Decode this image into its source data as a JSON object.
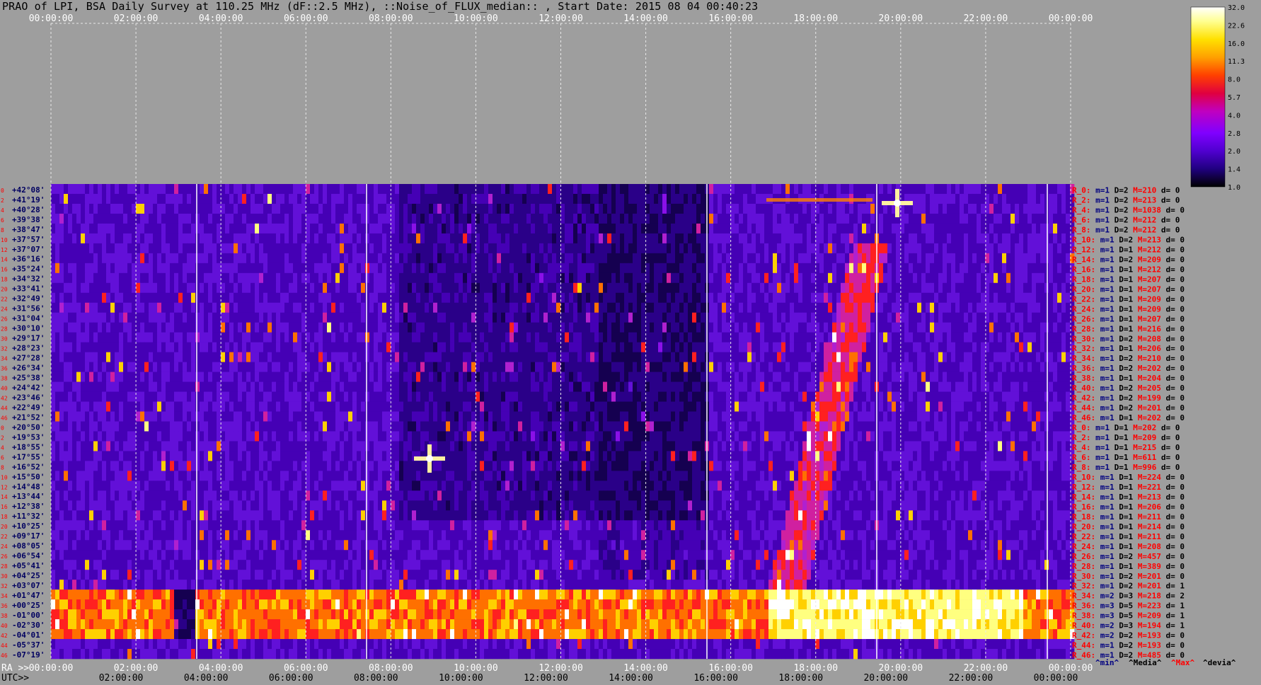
{
  "title": "PRAO of LPI, BSA Daily Survey at 110.25 MHz (dF::2.5 MHz), ::Noise_of_FLUX_median:: , Start Date: 2015 08 04 00:40:23",
  "chart_data": {
    "type": "heatmap",
    "top_axis_ticks": [
      "00:00:00",
      "02:00:00",
      "04:00:00",
      "06:00:00",
      "08:00:00",
      "10:00:00",
      "12:00:00",
      "14:00:00",
      "16:00:00",
      "18:00:00",
      "20:00:00",
      "22:00:00",
      "00:00:00"
    ],
    "ra_label": "RA >>",
    "ra_ticks": [
      "00:00:00",
      "02:00:00",
      "04:00:00",
      "06:00:00",
      "08:00:00",
      "10:00:00",
      "12:00:00",
      "14:00:00",
      "16:00:00",
      "18:00:00",
      "20:00:00",
      "22:00:00",
      "00:00:00"
    ],
    "utc_label": "UTC>>",
    "utc_ticks": [
      "02:00:00",
      "04:00:00",
      "06:00:00",
      "08:00:00",
      "10:00:00",
      "12:00:00",
      "14:00:00",
      "16:00:00",
      "18:00:00",
      "20:00:00",
      "22:00:00",
      "00:00:00"
    ],
    "declinations": [
      "+42°08'",
      "+41°19'",
      "+40°28'",
      "+39°38'",
      "+38°47'",
      "+37°57'",
      "+37°07'",
      "+36°16'",
      "+35°24'",
      "+34°32'",
      "+33°41'",
      "+32°49'",
      "+31°56'",
      "+31°04'",
      "+30°10'",
      "+29°17'",
      "+28°23'",
      "+27°28'",
      "+26°34'",
      "+25°38'",
      "+24°42'",
      "+23°46'",
      "+22°49'",
      "+21°52'",
      "+20°50'",
      "+19°53'",
      "+18°55'",
      "+17°55'",
      "+16°52'",
      "+15°50'",
      "+14°48'",
      "+13°44'",
      "+12°38'",
      "+11°32'",
      "+10°25'",
      "+09°17'",
      "+08°05'",
      "+06°54'",
      "+05°41'",
      "+04°25'",
      "+03°07'",
      "+01°47'",
      "+00°25'",
      "-01°00'",
      "-02°30'",
      "-04°01'",
      "-05°37'",
      "-07°19'"
    ],
    "colorbar_ticks": [
      "32.0",
      "22.6",
      "16.0",
      "11.3",
      "8.0",
      "5.7",
      "4.0",
      "2.8",
      "2.0",
      "1.4",
      "1.0"
    ],
    "colorbar_colors": [
      "#ffffff",
      "#ffff90",
      "#ffe000",
      "#ffa000",
      "#ff4000",
      "#e00040",
      "#c000c0",
      "#8000ff",
      "#5000d0",
      "#200080",
      "#000000"
    ],
    "receivers": [
      {
        "r": "R_0:",
        "m": "m=1",
        "D": "D=2",
        "M": "M=210",
        "d": "d= 0"
      },
      {
        "r": "R_2:",
        "m": "m=1",
        "D": "D=2",
        "M": "M=213",
        "d": "d= 0"
      },
      {
        "r": "R_4:",
        "m": "m=1",
        "D": "D=2",
        "M": "M=1038",
        "d": "d= 0"
      },
      {
        "r": "R_6:",
        "m": "m=1",
        "D": "D=2",
        "M": "M=212",
        "d": "d= 0"
      },
      {
        "r": "R_8:",
        "m": "m=1",
        "D": "D=2",
        "M": "M=212",
        "d": "d= 0"
      },
      {
        "r": "R_10:",
        "m": "m=1",
        "D": "D=2",
        "M": "M=213",
        "d": "d= 0"
      },
      {
        "r": "R_12:",
        "m": "m=1",
        "D": "D=1",
        "M": "M=212",
        "d": "d= 0"
      },
      {
        "r": "R_14:",
        "m": "m=1",
        "D": "D=2",
        "M": "M=209",
        "d": "d= 0"
      },
      {
        "r": "R_16:",
        "m": "m=1",
        "D": "D=1",
        "M": "M=212",
        "d": "d= 0"
      },
      {
        "r": "R_18:",
        "m": "m=1",
        "D": "D=1",
        "M": "M=207",
        "d": "d= 0"
      },
      {
        "r": "R_20:",
        "m": "m=1",
        "D": "D=1",
        "M": "M=207",
        "d": "d= 0"
      },
      {
        "r": "R_22:",
        "m": "m=1",
        "D": "D=1",
        "M": "M=209",
        "d": "d= 0"
      },
      {
        "r": "R_24:",
        "m": "m=1",
        "D": "D=1",
        "M": "M=209",
        "d": "d= 0"
      },
      {
        "r": "R_26:",
        "m": "m=1",
        "D": "D=1",
        "M": "M=207",
        "d": "d= 0"
      },
      {
        "r": "R_28:",
        "m": "m=1",
        "D": "D=1",
        "M": "M=216",
        "d": "d= 0"
      },
      {
        "r": "R_30:",
        "m": "m=1",
        "D": "D=2",
        "M": "M=208",
        "d": "d= 0"
      },
      {
        "r": "R_32:",
        "m": "m=1",
        "D": "D=1",
        "M": "M=206",
        "d": "d= 0"
      },
      {
        "r": "R_34:",
        "m": "m=1",
        "D": "D=2",
        "M": "M=210",
        "d": "d= 0"
      },
      {
        "r": "R_36:",
        "m": "m=1",
        "D": "D=2",
        "M": "M=202",
        "d": "d= 0"
      },
      {
        "r": "R_38:",
        "m": "m=1",
        "D": "D=1",
        "M": "M=204",
        "d": "d= 0"
      },
      {
        "r": "R_40:",
        "m": "m=1",
        "D": "D=2",
        "M": "M=205",
        "d": "d= 0"
      },
      {
        "r": "R_42:",
        "m": "m=1",
        "D": "D=2",
        "M": "M=199",
        "d": "d= 0"
      },
      {
        "r": "R_44:",
        "m": "m=1",
        "D": "D=2",
        "M": "M=201",
        "d": "d= 0"
      },
      {
        "r": "R_46:",
        "m": "m=1",
        "D": "D=1",
        "M": "M=202",
        "d": "d= 0"
      },
      {
        "r": "R_0:",
        "m": "m=1",
        "D": "D=1",
        "M": "M=202",
        "d": "d= 0"
      },
      {
        "r": "R_2:",
        "m": "m=1",
        "D": "D=1",
        "M": "M=209",
        "d": "d= 0"
      },
      {
        "r": "R_4:",
        "m": "m=1",
        "D": "D=1",
        "M": "M=215",
        "d": "d= 0"
      },
      {
        "r": "R_6:",
        "m": "m=1",
        "D": "D=1",
        "M": "M=611",
        "d": "d= 0"
      },
      {
        "r": "R_8:",
        "m": "m=1",
        "D": "D=1",
        "M": "M=996",
        "d": "d= 0"
      },
      {
        "r": "R_10:",
        "m": "m=1",
        "D": "D=1",
        "M": "M=224",
        "d": "d= 0"
      },
      {
        "r": "R_12:",
        "m": "m=1",
        "D": "D=1",
        "M": "M=221",
        "d": "d= 0"
      },
      {
        "r": "R_14:",
        "m": "m=1",
        "D": "D=1",
        "M": "M=213",
        "d": "d= 0"
      },
      {
        "r": "R_16:",
        "m": "m=1",
        "D": "D=1",
        "M": "M=206",
        "d": "d= 0"
      },
      {
        "r": "R_18:",
        "m": "m=1",
        "D": "D=1",
        "M": "M=211",
        "d": "d= 0"
      },
      {
        "r": "R_20:",
        "m": "m=1",
        "D": "D=1",
        "M": "M=214",
        "d": "d= 0"
      },
      {
        "r": "R_22:",
        "m": "m=1",
        "D": "D=1",
        "M": "M=211",
        "d": "d= 0"
      },
      {
        "r": "R_24:",
        "m": "m=1",
        "D": "D=1",
        "M": "M=208",
        "d": "d= 0"
      },
      {
        "r": "R_26:",
        "m": "m=1",
        "D": "D=2",
        "M": "M=457",
        "d": "d= 0"
      },
      {
        "r": "R_28:",
        "m": "m=1",
        "D": "D=1",
        "M": "M=389",
        "d": "d= 0"
      },
      {
        "r": "R_30:",
        "m": "m=1",
        "D": "D=2",
        "M": "M=201",
        "d": "d= 0"
      },
      {
        "r": "R_32:",
        "m": "m=1",
        "D": "D=2",
        "M": "M=201",
        "d": "d= 1"
      },
      {
        "r": "R_34:",
        "m": "m=2",
        "D": "D=3",
        "M": "M=218",
        "d": "d= 2"
      },
      {
        "r": "R_36:",
        "m": "m=3",
        "D": "D=5",
        "M": "M=223",
        "d": "d= 1"
      },
      {
        "r": "R_38:",
        "m": "m=3",
        "D": "D=5",
        "M": "M=209",
        "d": "d= 1"
      },
      {
        "r": "R_40:",
        "m": "m=2",
        "D": "D=3",
        "M": "M=194",
        "d": "d= 1"
      },
      {
        "r": "R_42:",
        "m": "m=2",
        "D": "D=2",
        "M": "M=193",
        "d": "d= 0"
      },
      {
        "r": "R_44:",
        "m": "m=1",
        "D": "D=2",
        "M": "M=193",
        "d": "d= 0"
      },
      {
        "r": "R_46:",
        "m": "m=1",
        "D": "D=2",
        "M": "M=485",
        "d": "d= 0"
      }
    ],
    "legend_keys": [
      "^min^",
      "^Media^",
      "^Max^",
      "^devia^"
    ],
    "colors": {
      "background": "#9e9e9e",
      "red_label": "#ff0000",
      "blue_label": "#000080",
      "hot_band": "#ff2000"
    }
  }
}
